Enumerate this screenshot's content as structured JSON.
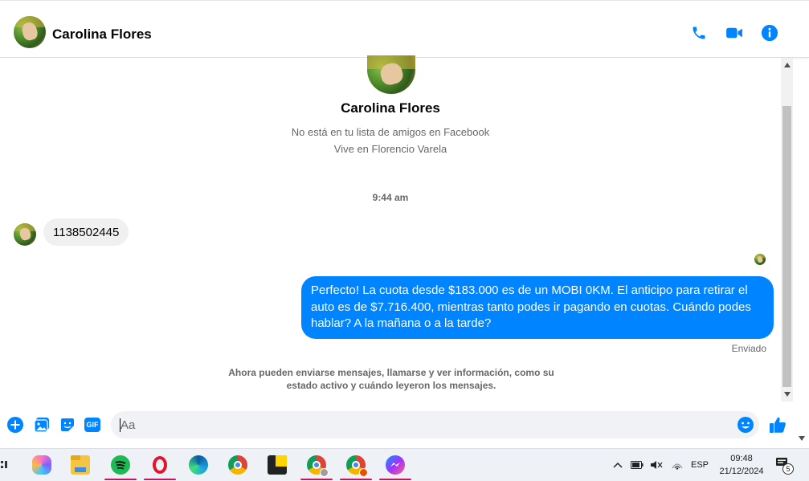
{
  "header": {
    "contact_name": "Carolina Flores",
    "call_icon": "phone-icon",
    "video_icon": "video-camera-icon",
    "info_icon": "info-icon"
  },
  "profile": {
    "name": "Carolina Flores",
    "friend_status": "No está en tu lista de amigos en Facebook",
    "location": "Vive en Florencio Varela"
  },
  "conversation": {
    "timestamp": "9:44 am",
    "incoming_message": "1138502445",
    "outgoing_message": "Perfecto! La cuota desde $183.000 es de un MOBI 0KM. El anticipo para retirar el auto es de $7.716.400, mientras tanto podes ir pagando en cuotas. Cuándo podes hablar? A la mañana o a la tarde?",
    "sent_status": "Enviado",
    "notice": "Ahora pueden enviarse mensajes, llamarse y ver información, como su estado activo y cuándo leyeron los mensajes."
  },
  "composer": {
    "placeholder": "Aa",
    "actions": [
      "plus-icon",
      "image-icon",
      "sticker-icon",
      "gif-icon"
    ],
    "gif_label": "GIF"
  },
  "taskbar": {
    "apps": [
      "copilot",
      "file-explorer",
      "spotify",
      "opera",
      "edge",
      "chrome",
      "sticky-notes",
      "chrome-profile-1",
      "chrome-profile-2",
      "messenger"
    ],
    "language": "ESP",
    "time": "09:48",
    "date": "21/12/2024",
    "notification_count": "5"
  },
  "colors": {
    "accent": "#0084ff",
    "incoming_bubble": "#f0f0f0",
    "secondary_text": "#65676b"
  }
}
